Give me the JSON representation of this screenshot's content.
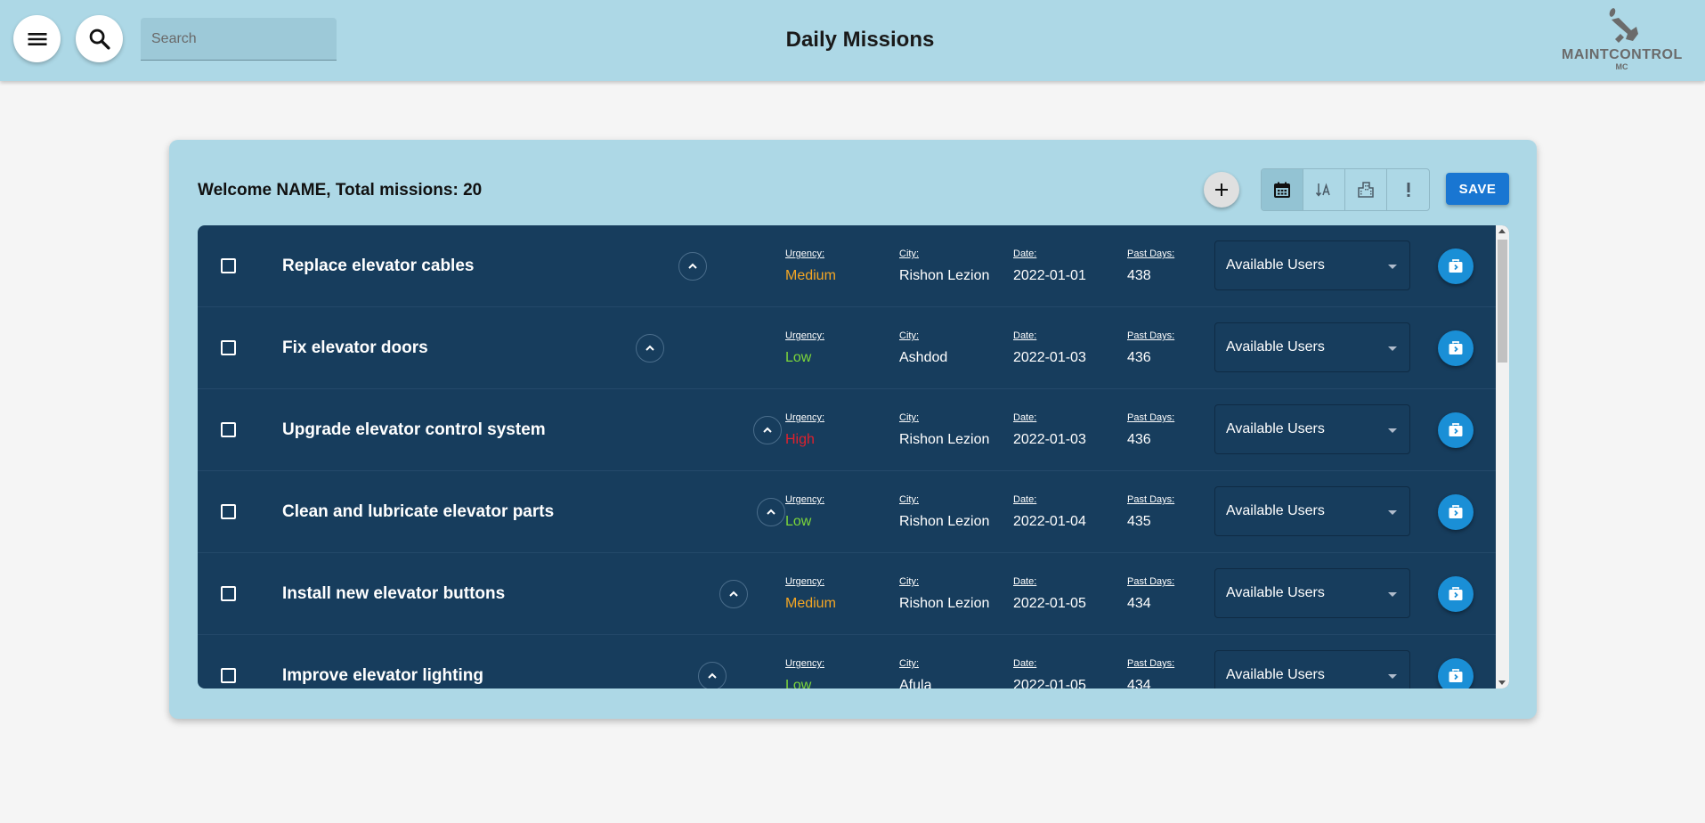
{
  "header": {
    "title": "Daily Missions",
    "search_placeholder": "Search",
    "logo_text": "MAINTCONTROL",
    "logo_sub": "MC"
  },
  "card": {
    "welcome": "Welcome NAME, Total missions: 20",
    "save_label": "SAVE",
    "sort_buttons": [
      "calendar-icon",
      "sort-alpha-icon",
      "city-icon",
      "urgency-icon"
    ]
  },
  "labels": {
    "urgency": "Urgency:",
    "city": "City:",
    "date": "Date:",
    "past_days": "Past Days:",
    "users_select": "Available Users"
  },
  "colors": {
    "medium": "#f5a623",
    "low": "#7cd63a",
    "high": "#e0202c",
    "list_bg": "#173d5d",
    "header_bg": "#add8e6",
    "save_bg": "#1976d2",
    "assign_bg": "#1a8fd6"
  },
  "missions": [
    {
      "title": "Replace elevator cables",
      "urgency": "Medium",
      "city": "Rishon Lezion",
      "date": "2022-01-01",
      "past_days": "438"
    },
    {
      "title": "Fix elevator doors",
      "urgency": "Low",
      "city": "Ashdod",
      "date": "2022-01-03",
      "past_days": "436"
    },
    {
      "title": "Upgrade elevator control system",
      "urgency": "High",
      "city": "Rishon Lezion",
      "date": "2022-01-03",
      "past_days": "436"
    },
    {
      "title": "Clean and lubricate elevator parts",
      "urgency": "Low",
      "city": "Rishon Lezion",
      "date": "2022-01-04",
      "past_days": "435"
    },
    {
      "title": "Install new elevator buttons",
      "urgency": "Medium",
      "city": "Rishon Lezion",
      "date": "2022-01-05",
      "past_days": "434"
    },
    {
      "title": "Improve elevator lighting",
      "urgency": "Low",
      "city": "Afula",
      "date": "2022-01-05",
      "past_days": "434"
    }
  ]
}
